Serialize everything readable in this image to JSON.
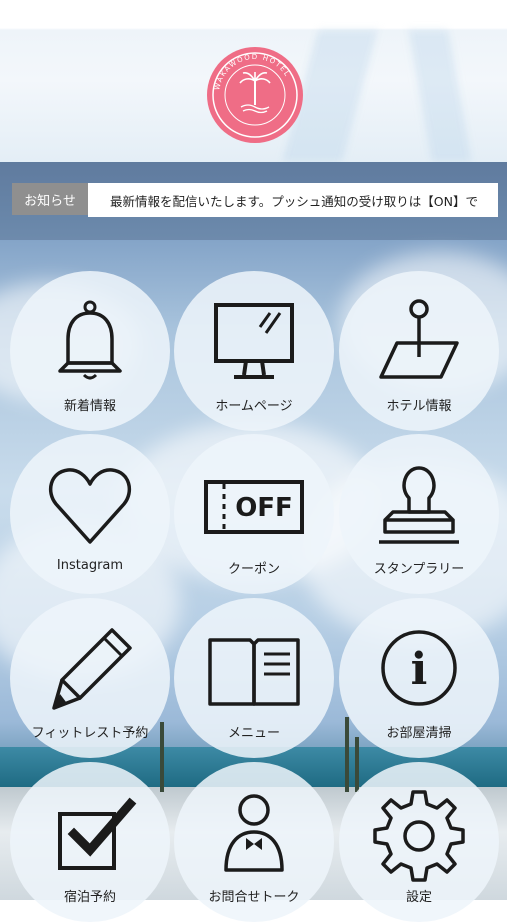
{
  "header": {
    "logo_ring_text": "WAKAWOOD HOTEL",
    "logo_subtext": "OKINAWA RESORT"
  },
  "notice": {
    "label": "お知らせ",
    "text": "最新情報を配信いたします。プッシュ通知の受け取りは【ON】で"
  },
  "menu": {
    "items": [
      {
        "label": "新着情報",
        "icon": "bell-icon"
      },
      {
        "label": "ホームページ",
        "icon": "monitor-icon"
      },
      {
        "label": "ホテル情報",
        "icon": "map-pin-icon"
      },
      {
        "label": "Instagram",
        "icon": "heart-icon"
      },
      {
        "label": "クーポン",
        "icon": "coupon-off-icon",
        "icon_text": "OFF"
      },
      {
        "label": "スタンプラリー",
        "icon": "stamp-icon"
      },
      {
        "label": "フィットレスト予約",
        "icon": "pencil-icon"
      },
      {
        "label": "メニュー",
        "icon": "book-icon"
      },
      {
        "label": "お部屋清掃",
        "icon": "info-icon",
        "icon_text": "i"
      },
      {
        "label": "宿泊予約",
        "icon": "checkbox-icon"
      },
      {
        "label": "お問合せトーク",
        "icon": "concierge-icon"
      },
      {
        "label": "設定",
        "icon": "gear-icon"
      }
    ]
  },
  "colors": {
    "logo": "#ef6d86",
    "notice_label_bg": "#8f8f8f",
    "tile_bg": "#eef4fa",
    "icon_stroke": "#1b1b1b"
  }
}
